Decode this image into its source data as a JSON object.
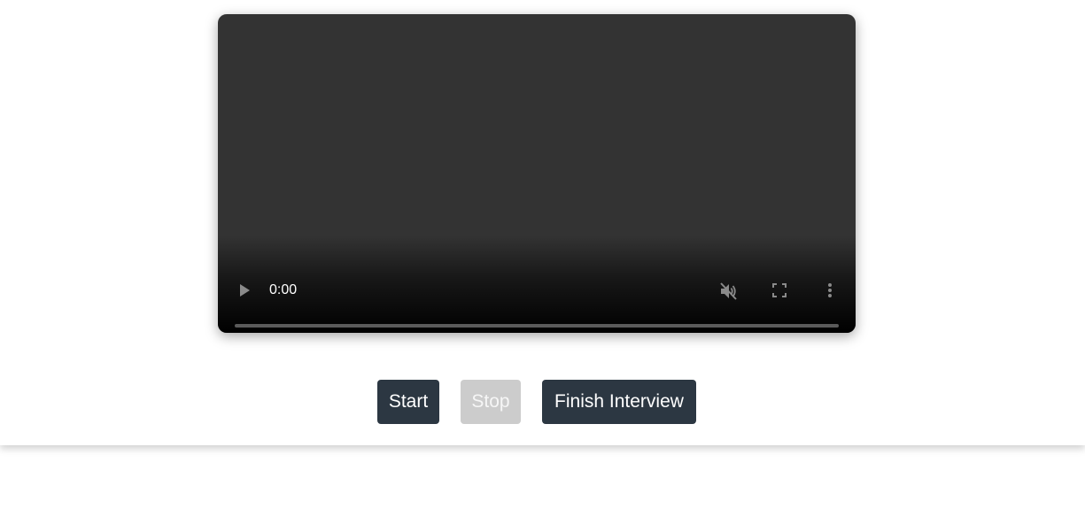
{
  "video_player": {
    "current_time": "0:00",
    "progress_fraction": 0,
    "muted": true,
    "icons": {
      "play": "play-icon",
      "mute": "volume-muted-icon",
      "fullscreen": "fullscreen-icon",
      "menu": "more-vertical-icon"
    }
  },
  "actions": {
    "start_label": "Start",
    "stop_label": "Stop",
    "finish_label": "Finish Interview",
    "stop_disabled": true
  },
  "colors": {
    "button_dark": "#2c3742",
    "button_disabled": "#cccccc",
    "video_bg": "#333333"
  }
}
